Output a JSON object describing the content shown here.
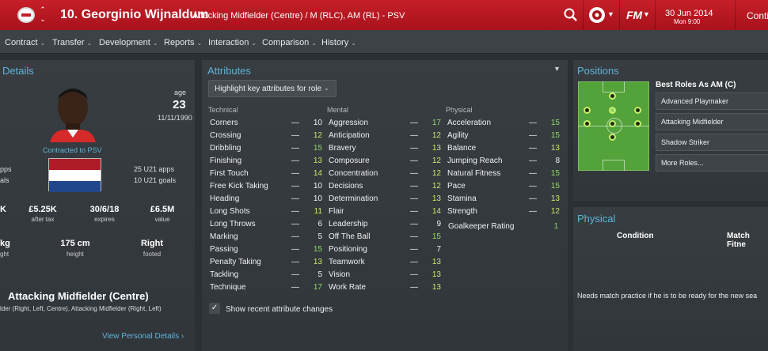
{
  "header": {
    "player_title": "10. Georginio Wijnaldum",
    "player_subtitle": "Attacking Midfielder (Centre) / M (RLC), AM (RL) - PSV",
    "fm_logo": "FM",
    "date": "30 Jun 2014",
    "time": "Mon 9:00",
    "continue_label": "Conti"
  },
  "menu": [
    {
      "label": "Contract"
    },
    {
      "label": "Transfer"
    },
    {
      "label": "Development"
    },
    {
      "label": "Reports"
    },
    {
      "label": "Interaction"
    },
    {
      "label": "Comparison"
    },
    {
      "label": "History"
    }
  ],
  "details": {
    "title": "Details",
    "age_label": "age",
    "age": "23",
    "dob": "11/11/1990",
    "contract_status": "Contracted to PSV",
    "apps_label": "pps",
    "goals_label": "als",
    "u21_apps": "25 U21 apps",
    "u21_goals": "10 U21 goals",
    "finance": [
      {
        "value": "K",
        "caption": ""
      },
      {
        "value": "£5.25K",
        "caption": "after tax"
      },
      {
        "value": "30/6/18",
        "caption": "expires"
      },
      {
        "value": "£6.5M",
        "caption": "value"
      }
    ],
    "physical": [
      {
        "value": "kg",
        "caption": "ght"
      },
      {
        "value": "175 cm",
        "caption": "height"
      },
      {
        "value": "Right",
        "caption": "footed"
      }
    ],
    "position_title": "Attacking Midfielder (Centre)",
    "position_desc": "lder (Right, Left, Centre), Attacking Midfielder (Right, Left)",
    "view_link": "View Personal Details"
  },
  "attributes": {
    "title": "Attributes",
    "highlight_dropdown": "Highlight key attributes for role",
    "columns": {
      "technical": "Technical",
      "mental": "Mental",
      "physical": "Physical"
    },
    "technical": [
      {
        "name": "Corners",
        "value": "10"
      },
      {
        "name": "Crossing",
        "value": "12"
      },
      {
        "name": "Dribbling",
        "value": "15"
      },
      {
        "name": "Finishing",
        "value": "13"
      },
      {
        "name": "First Touch",
        "value": "14"
      },
      {
        "name": "Free Kick Taking",
        "value": "10"
      },
      {
        "name": "Heading",
        "value": "10"
      },
      {
        "name": "Long Shots",
        "value": "11"
      },
      {
        "name": "Long Throws",
        "value": "6"
      },
      {
        "name": "Marking",
        "value": "5"
      },
      {
        "name": "Passing",
        "value": "15"
      },
      {
        "name": "Penalty Taking",
        "value": "13"
      },
      {
        "name": "Tackling",
        "value": "5"
      },
      {
        "name": "Technique",
        "value": "17"
      }
    ],
    "mental": [
      {
        "name": "Aggression",
        "value": "17"
      },
      {
        "name": "Anticipation",
        "value": "12"
      },
      {
        "name": "Bravery",
        "value": "13"
      },
      {
        "name": "Composure",
        "value": "12"
      },
      {
        "name": "Concentration",
        "value": "12"
      },
      {
        "name": "Decisions",
        "value": "12"
      },
      {
        "name": "Determination",
        "value": "13"
      },
      {
        "name": "Flair",
        "value": "14"
      },
      {
        "name": "Leadership",
        "value": "9"
      },
      {
        "name": "Off The Ball",
        "value": "15"
      },
      {
        "name": "Positioning",
        "value": "7"
      },
      {
        "name": "Teamwork",
        "value": "13"
      },
      {
        "name": "Vision",
        "value": "13"
      },
      {
        "name": "Work Rate",
        "value": "13"
      }
    ],
    "physical": [
      {
        "name": "Acceleration",
        "value": "15"
      },
      {
        "name": "Agility",
        "value": "15"
      },
      {
        "name": "Balance",
        "value": "13"
      },
      {
        "name": "Jumping Reach",
        "value": "8"
      },
      {
        "name": "Natural Fitness",
        "value": "15"
      },
      {
        "name": "Pace",
        "value": "15"
      },
      {
        "name": "Stamina",
        "value": "13"
      },
      {
        "name": "Strength",
        "value": "12"
      }
    ],
    "goalkeeper_rating_label": "Goalkeeper Rating",
    "goalkeeper_rating": "1",
    "recent_changes_label": "Show recent attribute changes",
    "colors": {
      "white": "#f0f0f0",
      "green_light": "#c8e66a",
      "green": "#8fd86a"
    }
  },
  "positions": {
    "title": "Positions",
    "best_roles_title": "Best Roles As AM (C)",
    "roles": [
      {
        "label": "Advanced Playmaker"
      },
      {
        "label": "Attacking Midfielder"
      },
      {
        "label": "Shadow Striker"
      },
      {
        "label": "More Roles..."
      }
    ]
  },
  "physical_panel": {
    "title": "Physical",
    "condition_label": "Condition",
    "match_fitness_label": "Match Fitne",
    "note": "Needs match practice if he is to be ready for the new sea"
  }
}
